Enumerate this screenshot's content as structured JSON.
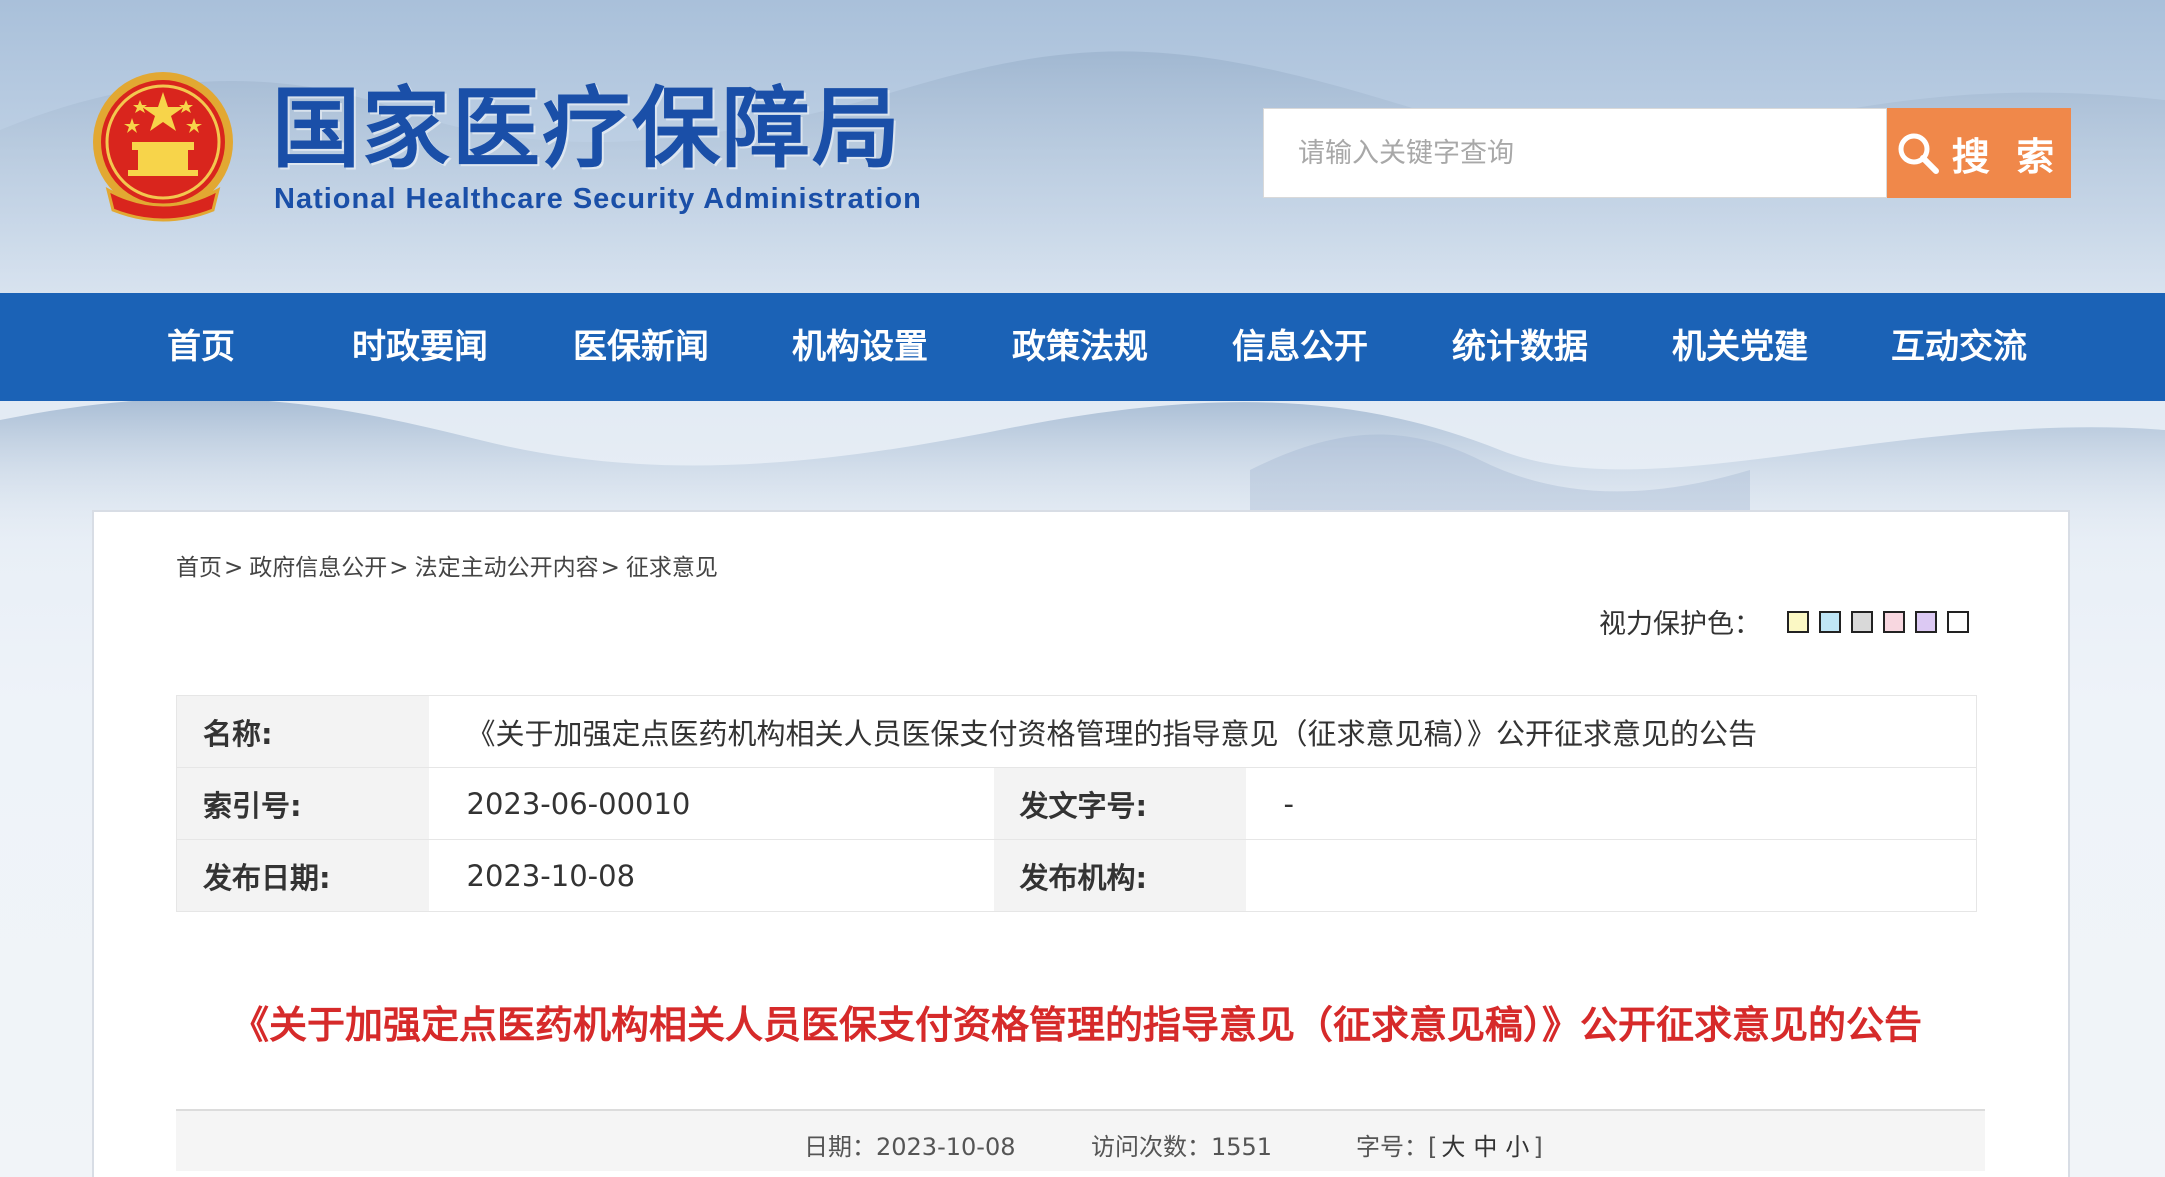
{
  "site": {
    "title": "国家医疗保障局",
    "subtitle": "National Healthcare Security Administration"
  },
  "search": {
    "placeholder": "请输入关键字查询",
    "button_label": "搜 索",
    "button_color": "#f0884a"
  },
  "nav": {
    "color": "#1b62b6",
    "items": [
      {
        "label": "首页"
      },
      {
        "label": "时政要闻"
      },
      {
        "label": "医保新闻"
      },
      {
        "label": "机构设置"
      },
      {
        "label": "政策法规"
      },
      {
        "label": "信息公开"
      },
      {
        "label": "统计数据"
      },
      {
        "label": "机关党建"
      },
      {
        "label": "互动交流"
      }
    ]
  },
  "breadcrumb": [
    {
      "label": "首页"
    },
    {
      "label": "政府信息公开"
    },
    {
      "label": "法定主动公开内容"
    },
    {
      "label": "征求意见"
    }
  ],
  "eye_care": {
    "label": "视力保护色：",
    "swatches": [
      "#fbf8c4",
      "#bfe6f6",
      "#d9d9d9",
      "#f8d7e0",
      "#dcc9f3",
      "#ffffff"
    ]
  },
  "meta": {
    "name_key": "名称:",
    "name_value": "《关于加强定点医药机构相关人员医保支付资格管理的指导意见（征求意见稿）》公开征求意见的公告",
    "index_key": "索引号:",
    "index_value": "2023-06-00010",
    "doc_no_key": "发文字号:",
    "doc_no_value": "-",
    "date_key": "发布日期:",
    "date_value": "2023-10-08",
    "org_key": "发布机构:",
    "org_value": ""
  },
  "article": {
    "title": "《关于加强定点医药机构相关人员医保支付资格管理的指导意见（征求意见稿）》公开征求意见的公告",
    "title_color": "#d62a2a"
  },
  "info_bar": {
    "date_label": "日期：",
    "date_value": "2023-10-08",
    "visits_label": "访问次数：",
    "visits_value": "1551",
    "font_label": "字号：[",
    "font_large": "大",
    "font_medium": "中",
    "font_small": "小",
    "font_end": "]"
  }
}
